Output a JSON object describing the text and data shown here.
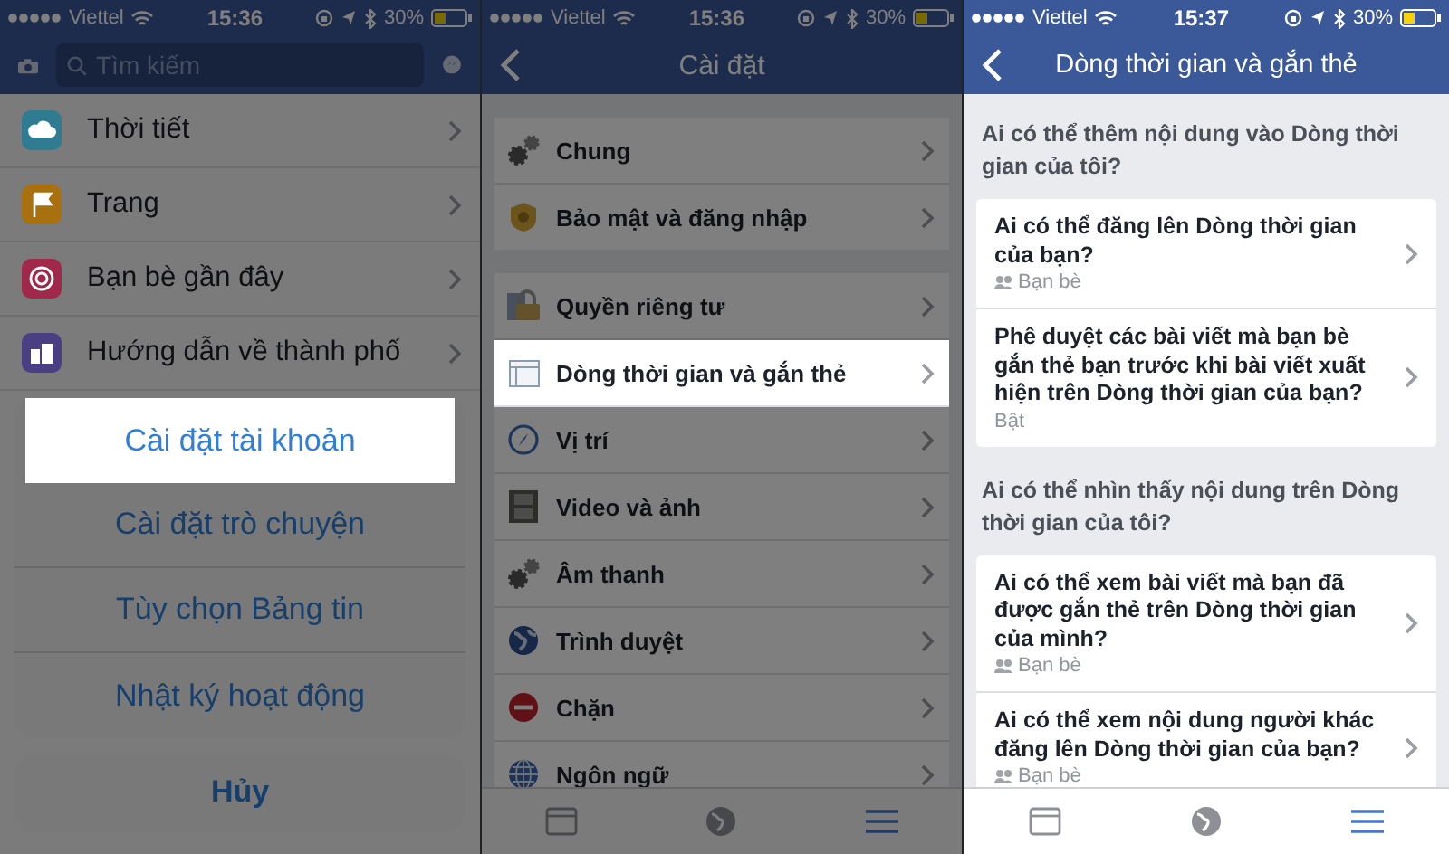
{
  "screens": [
    {
      "kind": "menu",
      "dimmed": true,
      "status_bar": {
        "carrier": "Viettel",
        "time": "15:36",
        "battery": "30%"
      },
      "search": {
        "placeholder": "Tìm kiếm"
      },
      "items": [
        {
          "label": "Thời tiết",
          "kind": "weather",
          "color": "#2f7c92"
        },
        {
          "label": "Trang",
          "kind": "flag",
          "color": "#a8700f"
        },
        {
          "label": "Bạn bè gần đây",
          "kind": "target",
          "color": "#a0284a"
        },
        {
          "label": "Hướng dẫn về thành phố",
          "kind": "city",
          "color": "#4a3f82"
        }
      ],
      "action_sheet": {
        "options": [
          {
            "label": "Cài đặt tài khoản",
            "selected": true
          },
          {
            "label": "Cài đặt trò chuyện",
            "selected": false
          },
          {
            "label": "Tùy chọn Bảng tin",
            "selected": false
          },
          {
            "label": "Nhật ký hoạt động",
            "selected": false
          }
        ],
        "cancel": "Hủy"
      }
    },
    {
      "kind": "settings",
      "dimmed": true,
      "status_bar": {
        "carrier": "Viettel",
        "time": "15:36",
        "battery": "30%"
      },
      "title": "Cài đặt",
      "groups": [
        {
          "items": [
            {
              "label": "Chung",
              "kind": "gears",
              "selected": false
            },
            {
              "label": "Bảo mật và đăng nhập",
              "kind": "badge",
              "selected": false
            }
          ]
        },
        {
          "items": [
            {
              "label": "Quyền riêng tư",
              "kind": "lock",
              "selected": false
            },
            {
              "label": "Dòng thời gian và gắn thẻ",
              "kind": "timeline",
              "selected": true
            },
            {
              "label": "Vị trí",
              "kind": "compass",
              "selected": false
            },
            {
              "label": "Video và ảnh",
              "kind": "film",
              "selected": false
            },
            {
              "label": "Âm thanh",
              "kind": "gears",
              "selected": false
            },
            {
              "label": "Trình duyệt",
              "kind": "globe",
              "selected": false
            },
            {
              "label": "Chặn",
              "kind": "block",
              "selected": false
            },
            {
              "label": "Ngôn ngữ",
              "kind": "grid-globe",
              "selected": false
            }
          ]
        }
      ],
      "tab_bar": [
        {
          "kind": "feed",
          "selected": false
        },
        {
          "kind": "globe",
          "selected": false
        },
        {
          "kind": "menu",
          "selected": true
        }
      ]
    },
    {
      "kind": "timeline",
      "status_bar": {
        "carrier": "Viettel",
        "time": "15:37",
        "battery": "30%"
      },
      "title": "Dòng thời gian và gắn thẻ",
      "sections": [
        {
          "heading": "Ai có thể thêm nội dung vào Dòng thời gian của tôi?",
          "items": [
            {
              "title": "Ai có thể đăng lên Dòng thời gian của bạn?",
              "value": "Bạn bè",
              "kind": "audience"
            },
            {
              "title": "Phê duyệt các bài viết mà bạn bè gắn thẻ bạn trước khi bài viết xuất hiện trên Dòng thời gian của bạn?",
              "value": "Bật",
              "kind": "plain"
            }
          ]
        },
        {
          "heading": "Ai có thể nhìn thấy nội dung trên Dòng thời gian của tôi?",
          "items": [
            {
              "title": "Ai có thể xem bài viết mà bạn đã được gắn thẻ trên Dòng thời gian của mình?",
              "value": "Bạn bè",
              "kind": "audience"
            },
            {
              "title": "Ai có thể xem nội dung người khác đăng lên Dòng thời gian của bạn?",
              "value": "Bạn bè",
              "kind": "audience"
            }
          ]
        }
      ],
      "tab_bar": [
        {
          "kind": "feed",
          "selected": false
        },
        {
          "kind": "globe",
          "selected": false
        },
        {
          "kind": "menu",
          "selected": true
        }
      ]
    }
  ]
}
